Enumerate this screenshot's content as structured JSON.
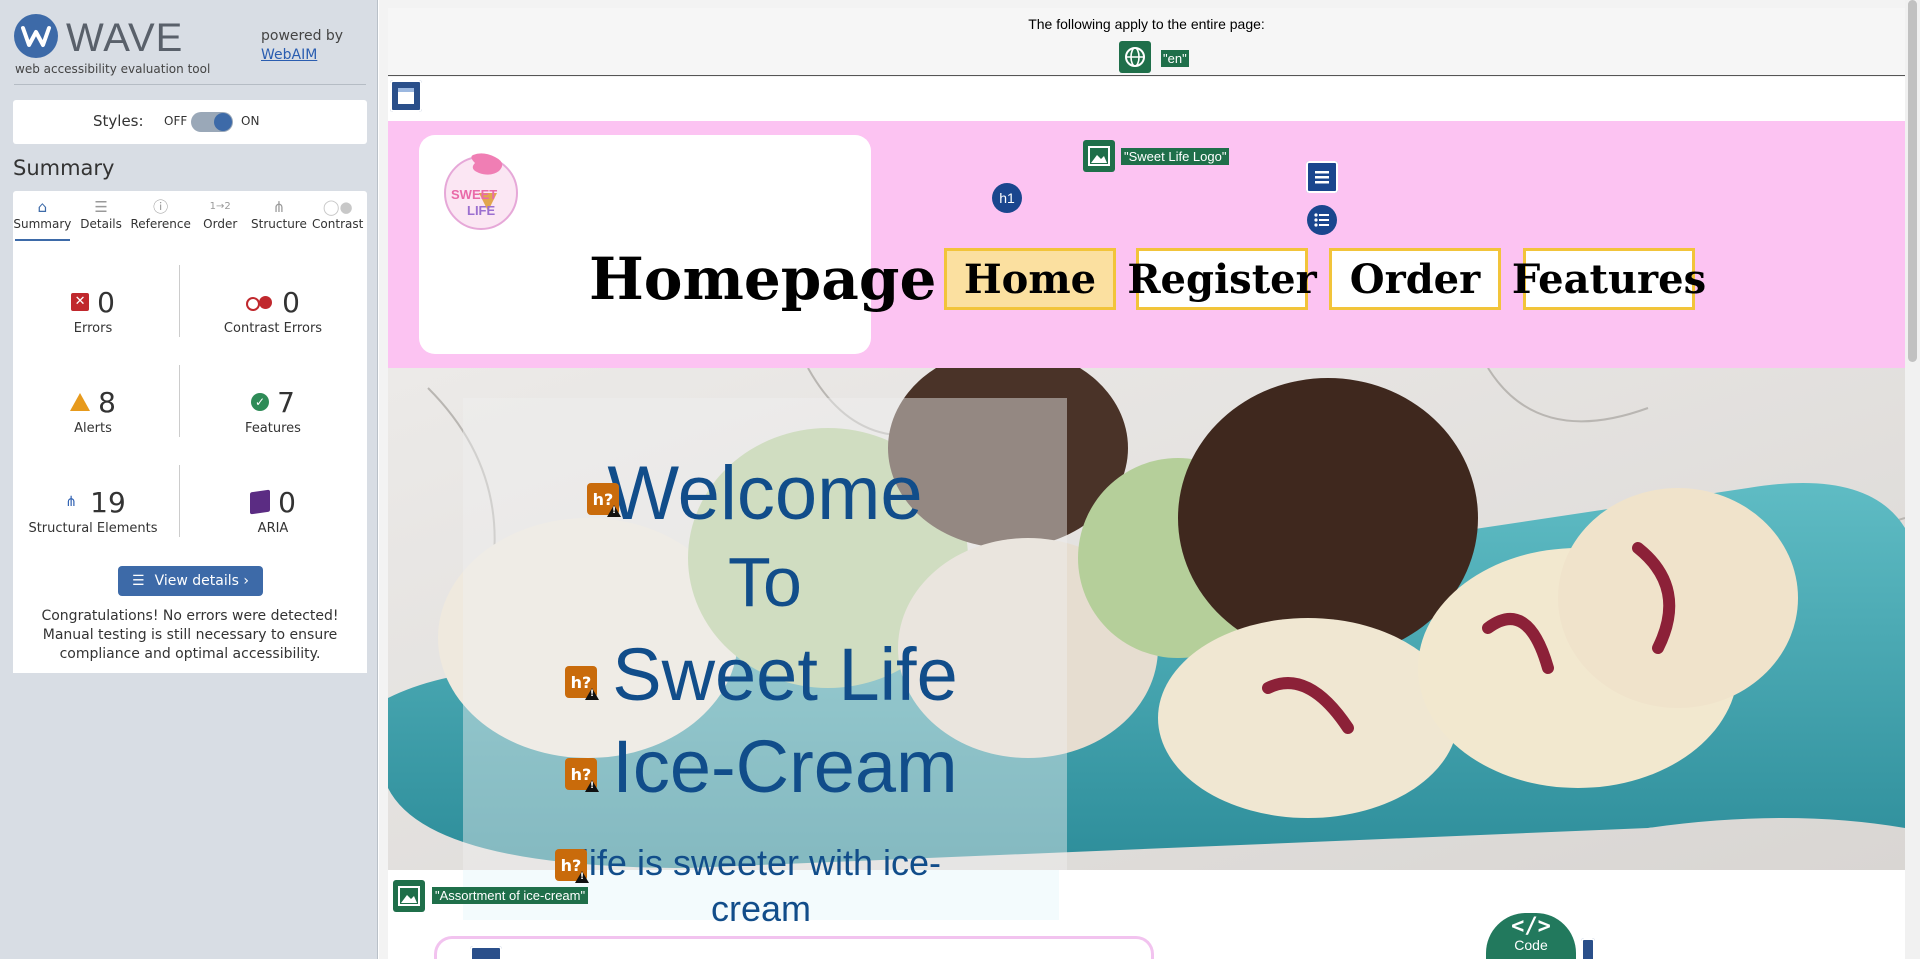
{
  "wave": {
    "title": "WAVE",
    "subtitle": "web accessibility evaluation tool",
    "powered_by": "powered by",
    "webaim": "WebAIM",
    "styles_label": "Styles:",
    "styles_off": "OFF",
    "styles_on": "ON",
    "styles_enabled": true,
    "summary_heading": "Summary",
    "tabs": [
      {
        "label": "Summary",
        "icon": "home-icon",
        "active": true
      },
      {
        "label": "Details",
        "icon": "list-icon"
      },
      {
        "label": "Reference",
        "icon": "info-icon"
      },
      {
        "label": "Order",
        "icon": "order-icon"
      },
      {
        "label": "Structure",
        "icon": "structure-icon"
      },
      {
        "label": "Contrast",
        "icon": "contrast-icon",
        "disabled": true
      }
    ],
    "stats": {
      "errors": {
        "value": "0",
        "label": "Errors"
      },
      "contrast_errors": {
        "value": "0",
        "label": "Contrast Errors"
      },
      "alerts": {
        "value": "8",
        "label": "Alerts"
      },
      "features": {
        "value": "7",
        "label": "Features"
      },
      "structural": {
        "value": "19",
        "label": "Structural Elements"
      },
      "aria": {
        "value": "0",
        "label": "ARIA"
      }
    },
    "view_details": "View details ›",
    "congrats": "Congratulations! No errors were detected! Manual testing is still necessary to ensure compliance and optimal accessibility."
  },
  "page": {
    "note": "The following apply to the entire page:",
    "lang": "\"en\"",
    "h1_badge": "h1",
    "logo_alt": "\"Sweet Life Logo\"",
    "logo_text": "SWEET LIFE",
    "title": "Homepage",
    "nav": [
      {
        "label": "Home",
        "current": true
      },
      {
        "label": "Register"
      },
      {
        "label": "Order"
      },
      {
        "label": "Features"
      }
    ],
    "hero": {
      "line1": "Welcome",
      "line2": "To",
      "line3": "Sweet Life",
      "line4": "Ice-Cream",
      "tagline1": "life is sweeter with ice-",
      "tagline2": "cream",
      "alert_badge": "h?",
      "image_alt": "\"Assortment of ice-cream\""
    },
    "code_label": "Code",
    "code_glyph": "</>"
  },
  "colors": {
    "wave_blue": "#3d6aa8",
    "header_pink": "#fcc3f2",
    "nav_border": "#f2c43a",
    "hero_text": "#114d8a",
    "feature_green": "#1f6f4a",
    "alert_orange": "#c96b0b"
  }
}
